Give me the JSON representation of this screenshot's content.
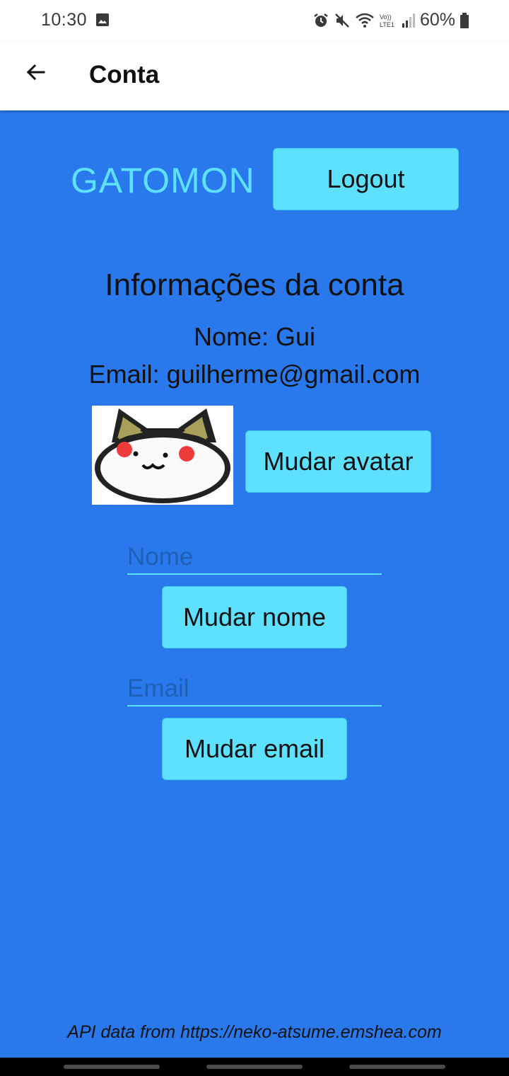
{
  "status_bar": {
    "time": "10:30",
    "battery": "60%",
    "icons": [
      "gallery-icon",
      "alarm-icon",
      "mute-icon",
      "wifi-icon",
      "volte-icon",
      "signal-icon",
      "battery-icon"
    ]
  },
  "app_bar": {
    "title": "Conta",
    "back_icon": "arrow-back-icon"
  },
  "brand": "GATOMON",
  "logout_label": "Logout",
  "account": {
    "heading": "Informações da conta",
    "name_line": "Nome: Gui",
    "email_line": "Email: guilherme@gmail.com"
  },
  "avatar": {
    "change_label": "Mudar avatar"
  },
  "name_field": {
    "placeholder": "Nome",
    "value": "",
    "button_label": "Mudar nome"
  },
  "email_field": {
    "placeholder": "Email",
    "value": "",
    "button_label": "Mudar email"
  },
  "footer": "API data from https://neko-atsume.emshea.com",
  "colors": {
    "background": "#2979ec",
    "accent": "#5ee1ff",
    "placeholder": "#1f5fb6"
  }
}
